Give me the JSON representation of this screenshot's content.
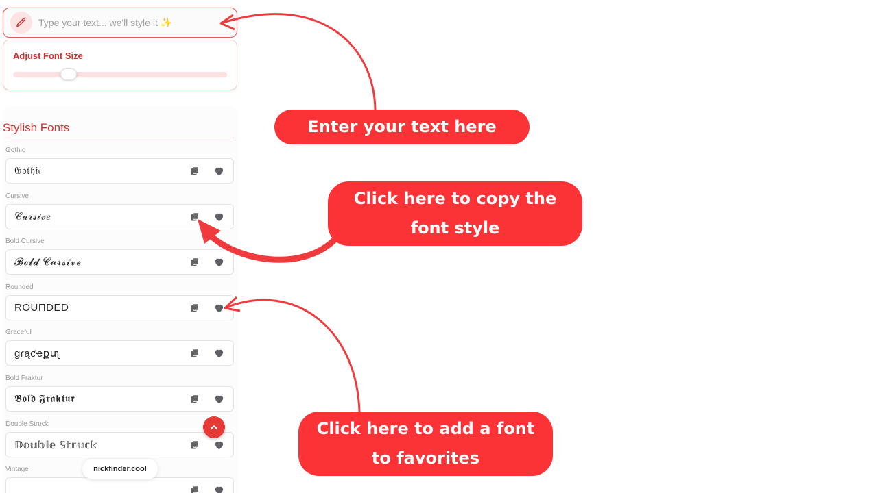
{
  "input": {
    "placeholder": "Type your text... we'll style it ✨",
    "icon": "pencil-icon"
  },
  "font_size": {
    "label": "Adjust Font Size",
    "slider_value": 0.24
  },
  "section": {
    "title": "Stylish Fonts"
  },
  "fonts": [
    {
      "label": "Gothic",
      "sample": "𝔊𝔬𝔱𝔥𝔦𝔠"
    },
    {
      "label": "Cursive",
      "sample": "𝒞𝓊𝓇𝓈𝒾𝓋𝑒"
    },
    {
      "label": "Bold Cursive",
      "sample": "𝓑𝓸𝓵𝓭 𝓒𝓾𝓻𝓼𝓲𝓿𝓮"
    },
    {
      "label": "Rounded",
      "sample": "ROUΠDED"
    },
    {
      "label": "Graceful",
      "sample": "gɾąƈҽքսʅ"
    },
    {
      "label": "Bold Fraktur",
      "sample": "𝕭𝖔𝖑𝖉 𝕱𝖗𝖆𝖐𝖙𝖚𝖗"
    },
    {
      "label": "Double Struck",
      "sample": "𝔻𝕠𝕦𝕓𝕝𝕖 𝕊𝕥𝕣𝕦𝕔𝕜"
    },
    {
      "label": "Vintage",
      "sample": ""
    }
  ],
  "row_icons": {
    "copy": "copy-icon",
    "favorite": "heart-icon"
  },
  "site_badge": "nickfinder.cool",
  "callouts": {
    "enter_text": "Enter your text here",
    "copy_style": "Click here to copy the font style",
    "add_favorite": "Click here to add a font to favorites"
  },
  "colors": {
    "accent": "#d32f2f",
    "callout": "#fb3236",
    "icon_gray": "#666666",
    "scroll_button": "#e53935"
  }
}
